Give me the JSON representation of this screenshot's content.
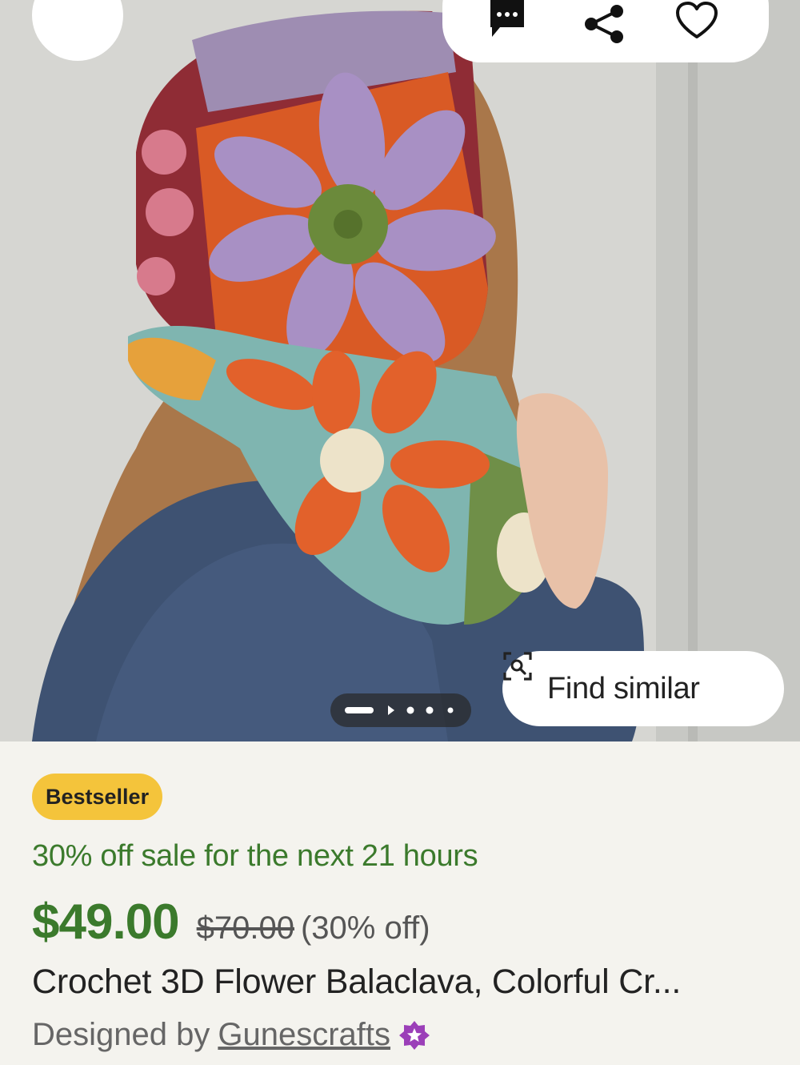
{
  "photo": {
    "alt_icon": "product-photo",
    "carousel_dot_count": 5,
    "carousel_active_index": 0
  },
  "toolbar": {
    "back_icon": "chevron-left-icon",
    "message_icon": "message-dots-icon",
    "share_icon": "share-icon",
    "favorite_icon": "heart-icon"
  },
  "find_similar": {
    "label": "Find similar",
    "icon": "image-search-icon"
  },
  "listing": {
    "badge": "Bestseller",
    "sale_text": "30% off sale for the next 21 hours",
    "price": "$49.00",
    "original_price": "$70.00",
    "discount": "(30% off)",
    "title": "Crochet 3D Flower Balaclava, Colorful Cr...",
    "designed_by": "Designed by",
    "shop_name": "Gunescrafts",
    "star_seller_icon": "star-seller-icon"
  },
  "colors": {
    "accent_green": "#3b7a2c",
    "badge_yellow": "#f4c43b",
    "star_purple": "#9b3fb8"
  }
}
